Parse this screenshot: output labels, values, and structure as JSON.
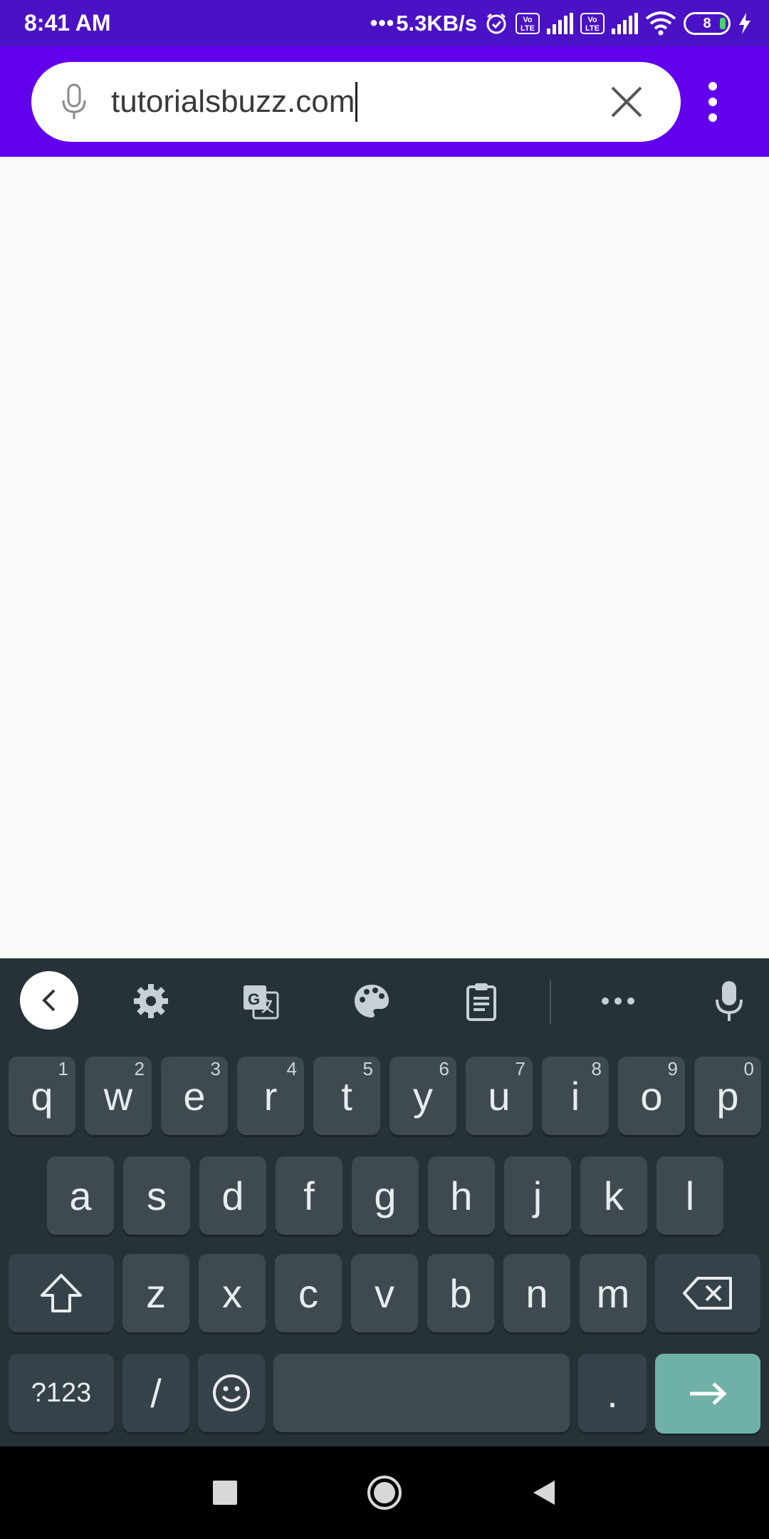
{
  "status_bar": {
    "time": "8:41 AM",
    "net_dots": "•••",
    "net_speed": "5.3KB/s",
    "volte_1": "Vo LTE",
    "volte_2": "Vo LTE",
    "battery_level": "8"
  },
  "search": {
    "value": "tutorialsbuzz.com"
  },
  "keyboard": {
    "row1": [
      {
        "label": "q",
        "hint": "1"
      },
      {
        "label": "w",
        "hint": "2"
      },
      {
        "label": "e",
        "hint": "3"
      },
      {
        "label": "r",
        "hint": "4"
      },
      {
        "label": "t",
        "hint": "5"
      },
      {
        "label": "y",
        "hint": "6"
      },
      {
        "label": "u",
        "hint": "7"
      },
      {
        "label": "i",
        "hint": "8"
      },
      {
        "label": "o",
        "hint": "9"
      },
      {
        "label": "p",
        "hint": "0"
      }
    ],
    "row2": [
      "a",
      "s",
      "d",
      "f",
      "g",
      "h",
      "j",
      "k",
      "l"
    ],
    "row3": [
      "z",
      "x",
      "c",
      "v",
      "b",
      "n",
      "m"
    ],
    "symbols_label": "?123",
    "slash_label": "/",
    "period_label": "."
  },
  "colors": {
    "status_bar": "#4a12c4",
    "toolbar": "#6200ee",
    "keyboard_bg": "#263238",
    "enter_key": "#6fb1a7"
  }
}
